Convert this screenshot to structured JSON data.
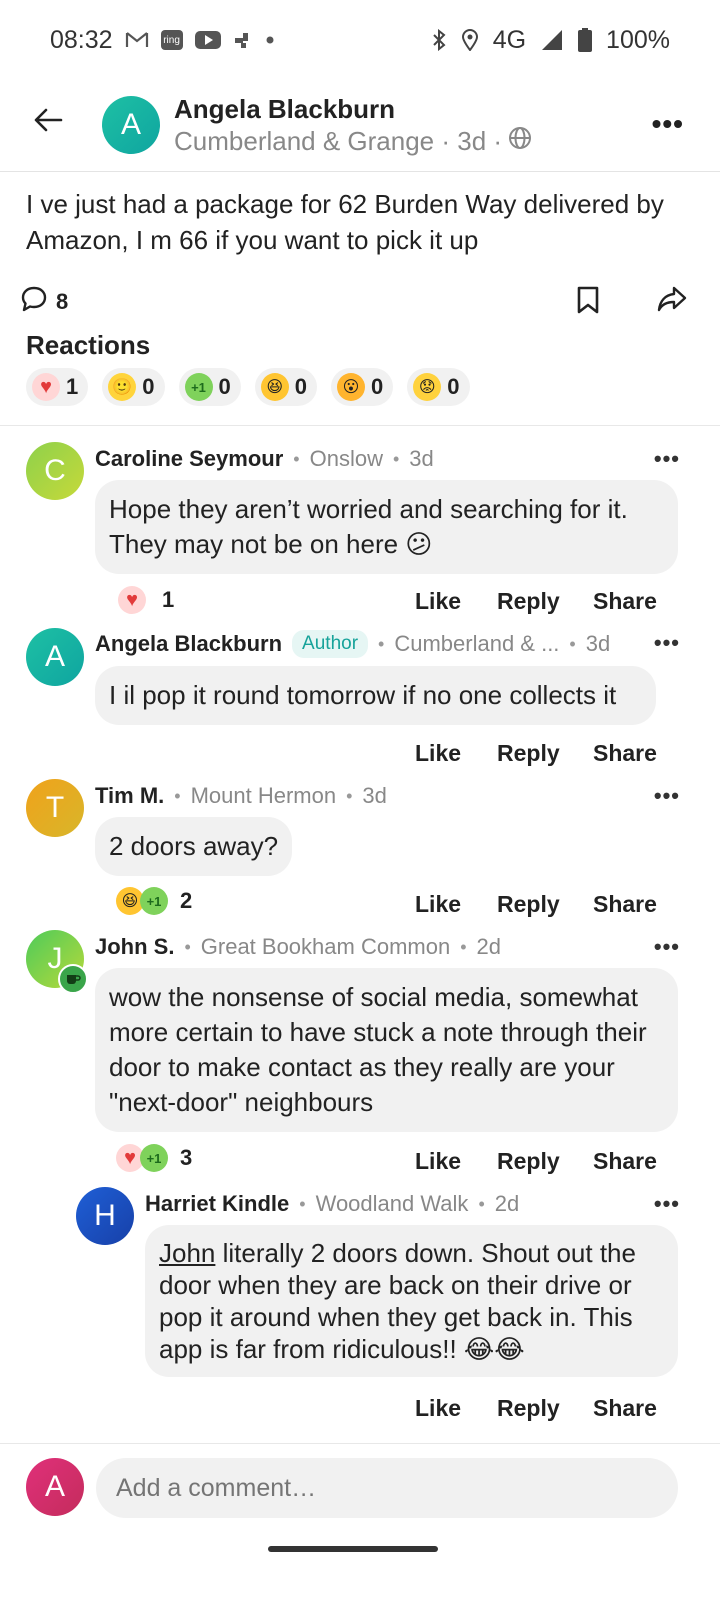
{
  "status_bar": {
    "time": "08:32",
    "network": "4G",
    "battery": "100%"
  },
  "header": {
    "avatar_letter": "A",
    "name": "Angela Blackburn",
    "meta": "Cumberland & Grange · 3d ·"
  },
  "post": {
    "text": "I ve just had a package for 62 Burden Way delivered by Amazon, I m 66 if you want to pick it up",
    "comment_count": "8",
    "reactions_title": "Reactions",
    "reactions": [
      {
        "icon": "heart",
        "count": "1"
      },
      {
        "icon": "smile",
        "count": "0"
      },
      {
        "icon": "plus-one",
        "count": "0"
      },
      {
        "icon": "laugh",
        "count": "0"
      },
      {
        "icon": "wow",
        "count": "0"
      },
      {
        "icon": "sad",
        "count": "0"
      }
    ]
  },
  "comments": [
    {
      "avatar_letter": "C",
      "name": "Caroline Seymour",
      "location": "Onslow",
      "time": "3d",
      "text": "Hope they aren’t worried and searching for it. They may not be on here 😕",
      "reaction_count": "1"
    },
    {
      "avatar_letter": "A",
      "name": "Angela Blackburn",
      "badge": "Author",
      "location": "Cumberland & ...",
      "time": "3d",
      "text": "I il pop it round tomorrow if no one collects it"
    },
    {
      "avatar_letter": "T",
      "name": "Tim M.",
      "location": "Mount Hermon",
      "time": "3d",
      "text": "2 doors away?",
      "reaction_count": "2"
    },
    {
      "avatar_letter": "J",
      "name": "John S.",
      "location": "Great Bookham Common",
      "time": "2d",
      "text": "wow the nonsense of social media, somewhat more certain to have stuck a note through their door to make contact as they really are your \"next-door\" neighbours",
      "reaction_count": "3"
    },
    {
      "avatar_letter": "H",
      "name": "Harriet Kindle",
      "location": "Woodland Walk",
      "time": "2d",
      "mention": "John",
      "text": " literally 2 doors down. Shout out the door when they are back on their drive or pop it around when they get back in. This app is far from ridiculous!! 😂😂"
    }
  ],
  "actions": {
    "like": "Like",
    "reply": "Reply",
    "share": "Share"
  },
  "composer": {
    "avatar_letter": "A",
    "placeholder": "Add a comment…"
  },
  "colors": {
    "author_badge": "#17a39a",
    "bubble_bg": "#f1f1f1"
  }
}
